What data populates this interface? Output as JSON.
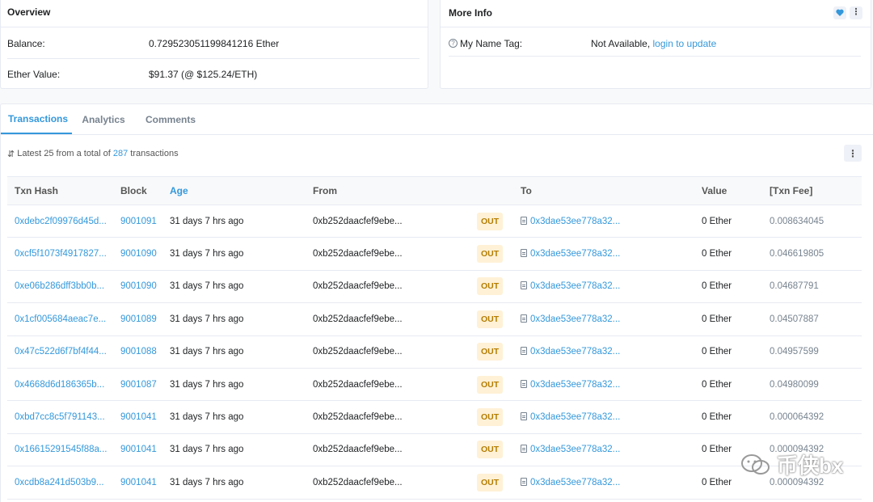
{
  "overview": {
    "title": "Overview",
    "balance_label": "Balance:",
    "balance_value": "0.729523051199841216 Ether",
    "ether_value_label": "Ether Value:",
    "ether_value": "$91.37 (@ $125.24/ETH)"
  },
  "more_info": {
    "title": "More Info",
    "name_tag_label": "My Name Tag:",
    "name_tag_value": "Not Available,",
    "name_tag_link": "login to update",
    "heart_icon": "heart-icon",
    "more_icon": "vertical-dots-icon"
  },
  "tabs": [
    {
      "label": "Transactions",
      "active": true
    },
    {
      "label": "Analytics",
      "active": false
    },
    {
      "label": "Comments",
      "active": false
    }
  ],
  "summary": {
    "prefix": "Latest 25 from a total of",
    "count": "287",
    "suffix": "transactions"
  },
  "table": {
    "headers": [
      "Txn Hash",
      "Block",
      "Age",
      "From",
      "",
      "To",
      "Value",
      "[Txn Fee]"
    ],
    "rows": [
      {
        "hash": "0xdebc2f09976d45d...",
        "block": "9001091",
        "age": "31 days 7 hrs ago",
        "from": "0xb252daacfef9ebe...",
        "dir": "OUT",
        "to": "0x3dae53ee778a32...",
        "value": "0 Ether",
        "fee": "0.008634045"
      },
      {
        "hash": "0xcf5f1073f4917827...",
        "block": "9001090",
        "age": "31 days 7 hrs ago",
        "from": "0xb252daacfef9ebe...",
        "dir": "OUT",
        "to": "0x3dae53ee778a32...",
        "value": "0 Ether",
        "fee": "0.046619805"
      },
      {
        "hash": "0xe06b286dff3bb0b...",
        "block": "9001090",
        "age": "31 days 7 hrs ago",
        "from": "0xb252daacfef9ebe...",
        "dir": "OUT",
        "to": "0x3dae53ee778a32...",
        "value": "0 Ether",
        "fee": "0.04687791"
      },
      {
        "hash": "0x1cf005684aeac7e...",
        "block": "9001089",
        "age": "31 days 7 hrs ago",
        "from": "0xb252daacfef9ebe...",
        "dir": "OUT",
        "to": "0x3dae53ee778a32...",
        "value": "0 Ether",
        "fee": "0.04507887"
      },
      {
        "hash": "0x47c522d6f7bf4f44...",
        "block": "9001088",
        "age": "31 days 7 hrs ago",
        "from": "0xb252daacfef9ebe...",
        "dir": "OUT",
        "to": "0x3dae53ee778a32...",
        "value": "0 Ether",
        "fee": "0.04957599"
      },
      {
        "hash": "0x4668d6d186365b...",
        "block": "9001087",
        "age": "31 days 7 hrs ago",
        "from": "0xb252daacfef9ebe...",
        "dir": "OUT",
        "to": "0x3dae53ee778a32...",
        "value": "0 Ether",
        "fee": "0.04980099"
      },
      {
        "hash": "0xbd7cc8c5f791143...",
        "block": "9001041",
        "age": "31 days 7 hrs ago",
        "from": "0xb252daacfef9ebe...",
        "dir": "OUT",
        "to": "0x3dae53ee778a32...",
        "value": "0 Ether",
        "fee": "0.000064392"
      },
      {
        "hash": "0x16615291545f88a...",
        "block": "9001041",
        "age": "31 days 7 hrs ago",
        "from": "0xb252daacfef9ebe...",
        "dir": "OUT",
        "to": "0x3dae53ee778a32...",
        "value": "0 Ether",
        "fee": "0.000094392"
      },
      {
        "hash": "0xcdb8a241d503b9...",
        "block": "9001041",
        "age": "31 days 7 hrs ago",
        "from": "0xb252daacfef9ebe...",
        "dir": "OUT",
        "to": "0x3dae53ee778a32...",
        "value": "0 Ether",
        "fee": "0.000094392"
      }
    ]
  },
  "watermark": {
    "text": "币侠bx",
    "logo": "wechat-logo"
  },
  "colors": {
    "link": "#3498db",
    "out_badge_bg": "#fff1d6",
    "out_badge_text": "#b47d00",
    "border": "#e7eaf3"
  }
}
